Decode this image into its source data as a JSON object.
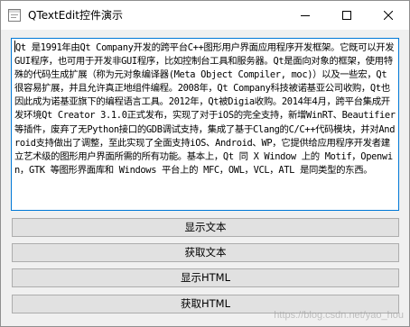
{
  "window": {
    "title": "QTextEdit控件演示"
  },
  "textedit": {
    "content": "Qt 是1991年由Qt Company开发的跨平台C++图形用户界面应用程序开发框架。它既可以开发GUI程序，也可用于开发非GUI程序，比如控制台工具和服务器。Qt是面向对象的框架，使用特殊的代码生成扩展（称为元对象编译器(Meta Object Compiler, moc)）以及一些宏，Qt很容易扩展，并且允许真正地组件编程。2008年，Qt Company科技被诺基亚公司收购，Qt也因此成为诺基亚旗下的编程语言工具。2012年，Qt被Digia收购。2014年4月，跨平台集成开发环境Qt Creator 3.1.0正式发布，实现了对于iOS的完全支持，新增WinRT、Beautifier等插件，废弃了无Python接口的GDB调试支持，集成了基于Clang的C/C++代码模块，并对Android支持做出了调整，至此实现了全面支持iOS、Android、WP，它提供给应用程序开发者建立艺术级的图形用户界面所需的所有功能。基本上，Qt 同 X Window 上的 Motif，Openwin，GTK 等图形界面库和 Windows 平台上的 MFC，OWL，VCL，ATL 是同类型的东西。"
  },
  "buttons": {
    "show_text": "显示文本",
    "get_text": "获取文本",
    "show_html": "显示HTML",
    "get_html": "获取HTML"
  },
  "watermark": "https://blog.csdn.net/yao_hou"
}
